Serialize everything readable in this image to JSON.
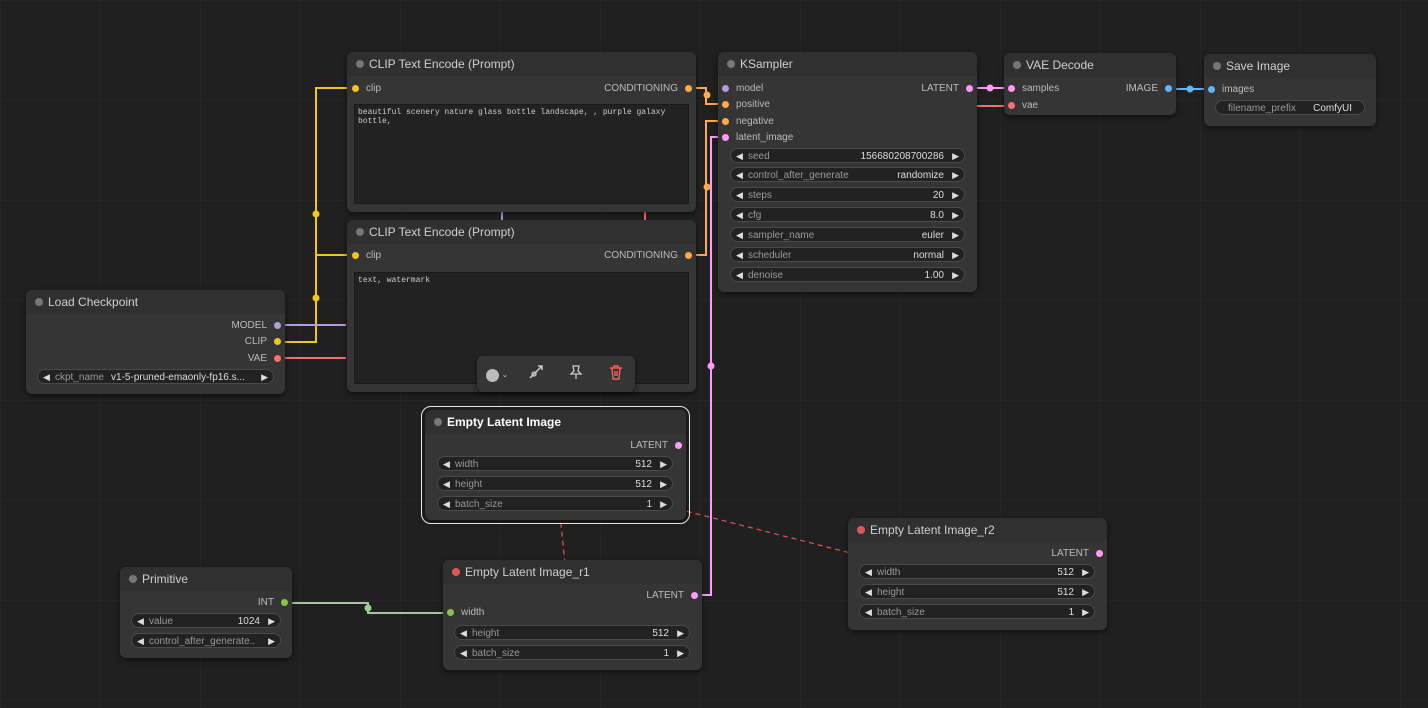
{
  "nodes": {
    "clip1": {
      "title": "CLIP Text Encode (Prompt)",
      "input": "clip",
      "output": "CONDITIONING",
      "text": "beautiful scenery nature glass bottle landscape, , purple galaxy bottle,"
    },
    "clip2": {
      "title": "CLIP Text Encode (Prompt)",
      "input": "clip",
      "output": "CONDITIONING",
      "text": "text, watermark"
    },
    "ksampler": {
      "title": "KSampler",
      "inputs": [
        "model",
        "positive",
        "negative",
        "latent_image"
      ],
      "output": "LATENT",
      "widgets": [
        {
          "label": "seed",
          "value": "156680208700286"
        },
        {
          "label": "control_after_generate",
          "value": "randomize"
        },
        {
          "label": "steps",
          "value": "20"
        },
        {
          "label": "cfg",
          "value": "8.0"
        },
        {
          "label": "sampler_name",
          "value": "euler"
        },
        {
          "label": "scheduler",
          "value": "normal"
        },
        {
          "label": "denoise",
          "value": "1.00"
        }
      ]
    },
    "vae_decode": {
      "title": "VAE Decode",
      "inputs": [
        "samples",
        "vae"
      ],
      "output": "IMAGE"
    },
    "save_image": {
      "title": "Save Image",
      "input": "images",
      "widget": {
        "label": "filename_prefix",
        "value": "ComfyUI"
      }
    },
    "load_checkpoint": {
      "title": "Load Checkpoint",
      "outputs": [
        "MODEL",
        "CLIP",
        "VAE"
      ],
      "widget": {
        "label": "ckpt_name",
        "value": "v1-5-pruned-emaonly-fp16.s..."
      }
    },
    "empty_latent": {
      "title": "Empty Latent Image",
      "output": "LATENT",
      "widgets": [
        {
          "label": "width",
          "value": "512"
        },
        {
          "label": "height",
          "value": "512"
        },
        {
          "label": "batch_size",
          "value": "1"
        }
      ]
    },
    "empty_latent_r1": {
      "title": "Empty Latent Image_r1",
      "input": "width",
      "output": "LATENT",
      "widgets": [
        {
          "label": "height",
          "value": "512"
        },
        {
          "label": "batch_size",
          "value": "1"
        }
      ]
    },
    "empty_latent_r2": {
      "title": "Empty Latent Image_r2",
      "output": "LATENT",
      "widgets": [
        {
          "label": "width",
          "value": "512"
        },
        {
          "label": "height",
          "value": "512"
        },
        {
          "label": "batch_size",
          "value": "1"
        }
      ]
    },
    "primitive": {
      "title": "Primitive",
      "output": "INT",
      "widgets": [
        {
          "label": "value",
          "value": "1024"
        },
        {
          "label": "control_after_generate..",
          "value": ""
        }
      ]
    }
  },
  "toolbar": {
    "items": [
      "color-picker-icon",
      "bypass-icon",
      "pin-icon",
      "delete-icon"
    ]
  },
  "colors": {
    "clip": "#f5c518",
    "model": "#b39ddb",
    "vae": "#ff6e6e",
    "conditioning": "#ffa94d",
    "latent": "#ff9cf9",
    "image": "#64b5f6",
    "int": "#8bc34a",
    "link_red": "#e05555"
  }
}
